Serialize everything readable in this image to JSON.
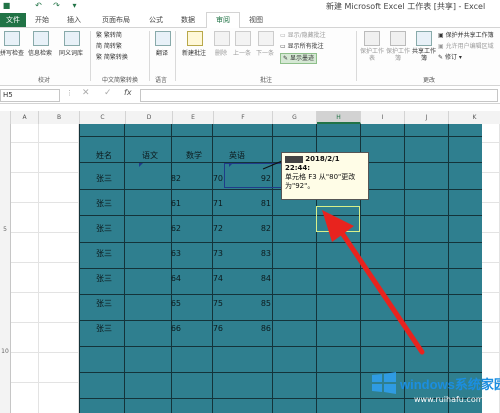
{
  "title_bar": {
    "title": "新建 Microsoft Excel 工作表 [共享] - Excel"
  },
  "tabs": {
    "file": "文件",
    "home": "开始",
    "insert": "插入",
    "layout": "页面布局",
    "formulas": "公式",
    "data": "数据",
    "review": "审阅",
    "view": "视图"
  },
  "ribbon": {
    "proofing": {
      "spelling": "拼写检查",
      "research": "信息检索",
      "thesaurus": "同义词库",
      "label": "校对"
    },
    "chinese": {
      "to_simplified": "繁转简",
      "to_traditional": "简转繁",
      "convert": "简繁转换",
      "label": "中文简繁转换"
    },
    "language": {
      "translate": "翻译",
      "label": "语言"
    },
    "comments": {
      "new": "新建批注",
      "delete": "删除",
      "prev": "上一条",
      "next": "下一条",
      "show_hide": "显示/隐藏批注",
      "show_all": "显示所有批注",
      "show_ink": "显示墨迹",
      "label": "批注"
    },
    "changes": {
      "protect_sheet": "保护工作表",
      "protect_book": "保护工作簿",
      "share": "共享工作簿",
      "protect_share": "保护并共享工作簿",
      "allow_edit": "允许用户编辑区域",
      "track": "修订",
      "label": "更改"
    }
  },
  "formula_bar": {
    "name_box": "H5",
    "fx": "fx"
  },
  "columns": [
    "A",
    "B",
    "C",
    "D",
    "E",
    "F",
    "G",
    "H",
    "I",
    "J",
    "K"
  ],
  "row_headers": [
    "5",
    "10"
  ],
  "table": {
    "headers": [
      "姓名",
      "语文",
      "数学",
      "英语"
    ],
    "rows": [
      {
        "name": "张三",
        "chinese": "82",
        "math": "70",
        "english": "92"
      },
      {
        "name": "张三",
        "chinese": "61",
        "math": "71",
        "english": "81"
      },
      {
        "name": "张三",
        "chinese": "62",
        "math": "72",
        "english": "82"
      },
      {
        "name": "张三",
        "chinese": "63",
        "math": "73",
        "english": "83"
      },
      {
        "name": "张三",
        "chinese": "64",
        "math": "74",
        "english": "84"
      },
      {
        "name": "张三",
        "chinese": "65",
        "math": "75",
        "english": "85"
      },
      {
        "name": "张三",
        "chinese": "66",
        "math": "76",
        "english": "86"
      }
    ]
  },
  "comment": {
    "header": "2018/2/1",
    "time": "22:44:",
    "body": "单元格 F3 从\"80\"更改为\"92\"。"
  },
  "watermark": {
    "brand": "windows系统家园",
    "url": "www.ruihafu.com"
  },
  "colors": {
    "excel_green": "#217346",
    "table_fill": "#2f7f8f",
    "arrow": "#e8231e"
  }
}
